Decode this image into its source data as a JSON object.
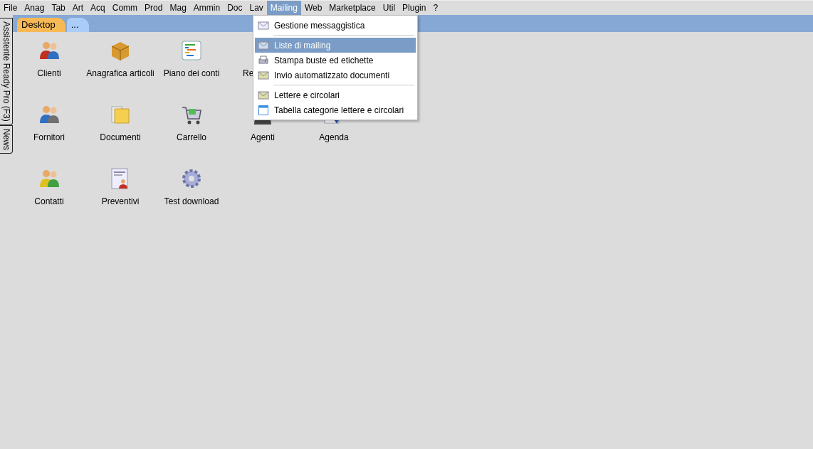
{
  "menu_bar": [
    {
      "label": "File",
      "selected": false
    },
    {
      "label": "Anag",
      "selected": false
    },
    {
      "label": "Tab",
      "selected": false
    },
    {
      "label": "Art",
      "selected": false
    },
    {
      "label": "Acq",
      "selected": false
    },
    {
      "label": "Comm",
      "selected": false
    },
    {
      "label": "Prod",
      "selected": false
    },
    {
      "label": "Mag",
      "selected": false
    },
    {
      "label": "Ammin",
      "selected": false
    },
    {
      "label": "Doc",
      "selected": false
    },
    {
      "label": "Lav",
      "selected": false
    },
    {
      "label": "Mailing",
      "selected": true
    },
    {
      "label": "Web",
      "selected": false
    },
    {
      "label": "Marketplace",
      "selected": false
    },
    {
      "label": "Util",
      "selected": false
    },
    {
      "label": "Plugin",
      "selected": false
    },
    {
      "label": "?",
      "selected": false
    }
  ],
  "side_tabs": [
    "Assistente Ready Pro (F3)",
    "News"
  ],
  "tabs": [
    {
      "label": "Desktop",
      "selected": true
    },
    {
      "label": "...",
      "selected": false
    }
  ],
  "desktop_icons": [
    [
      {
        "label": "Clienti",
        "cut": false
      },
      {
        "label": "Anagrafica articoli",
        "cut": false
      },
      {
        "label": "Piano dei conti",
        "cut": false
      },
      {
        "label": "Re",
        "cut": true
      }
    ],
    [
      {
        "label": "Fornitori",
        "cut": false
      },
      {
        "label": "Documenti",
        "cut": false
      },
      {
        "label": "Carrello",
        "cut": false
      },
      {
        "label": "Agenti",
        "cut": false
      },
      {
        "label": "Agenda",
        "cut": false
      }
    ],
    [
      {
        "label": "Contatti",
        "cut": false
      },
      {
        "label": "Preventivi",
        "cut": false
      },
      {
        "label": "Test download",
        "cut": false
      }
    ]
  ],
  "dropdown_menu": {
    "groups": [
      [
        {
          "label": "Gestione messaggistica",
          "selected": false
        }
      ],
      [
        {
          "label": "Liste di mailing",
          "selected": true
        },
        {
          "label": "Stampa buste ed etichette",
          "selected": false
        },
        {
          "label": "Invio automatizzato documenti",
          "selected": false
        }
      ],
      [
        {
          "label": "Lettere e circolari",
          "selected": false
        },
        {
          "label": "Tabella categorie lettere e circolari",
          "selected": false
        }
      ]
    ]
  }
}
